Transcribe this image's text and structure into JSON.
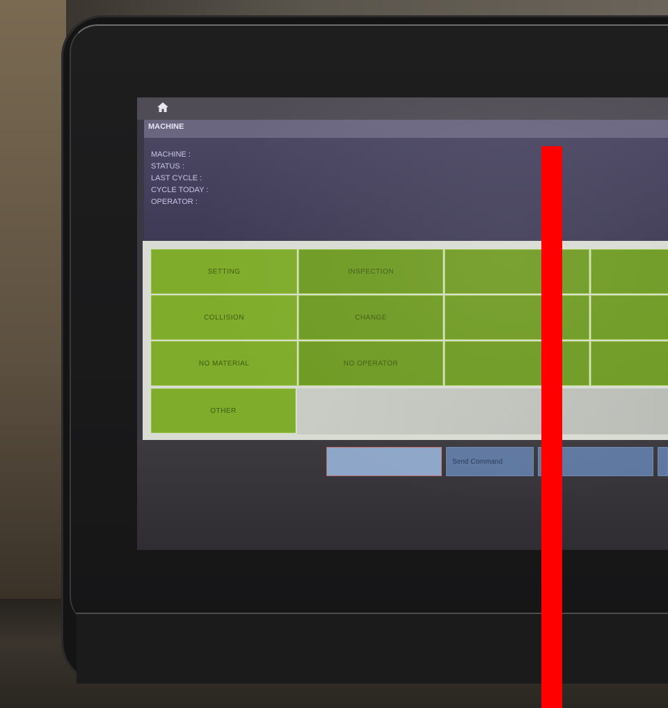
{
  "app": {
    "title": "MACHINE"
  },
  "status_bar": {
    "home_icon": "home-icon"
  },
  "info": {
    "left_lines": [
      "MACHINE : ",
      "STATUS : ",
      "LAST CYCLE : ",
      "CYCLE TODAY : ",
      "OPERATOR : "
    ],
    "right_lines": [
      "",
      "",
      "",
      ""
    ]
  },
  "grid": {
    "rows": [
      [
        "SETTING",
        "INSPECTION",
        "",
        ""
      ],
      [
        "COLLISION",
        "CHANGE",
        "",
        ""
      ],
      [
        "NO MATERIAL",
        "NO OPERATOR",
        "",
        ""
      ],
      [
        "OTHER"
      ]
    ]
  },
  "actions": {
    "buttons": [
      {
        "label": "",
        "name": "action-button-1"
      },
      {
        "label": "Send Command",
        "name": "send-command-button"
      },
      {
        "label": "",
        "name": "action-button-3"
      },
      {
        "label": "",
        "name": "action-button-4"
      }
    ]
  },
  "colors": {
    "grid_button": "#7fac2a",
    "info_panel": "#4a4662",
    "title_bar": "#6a6680",
    "action_button": "#5f78a0",
    "overlay_bar": "#ff0000"
  }
}
